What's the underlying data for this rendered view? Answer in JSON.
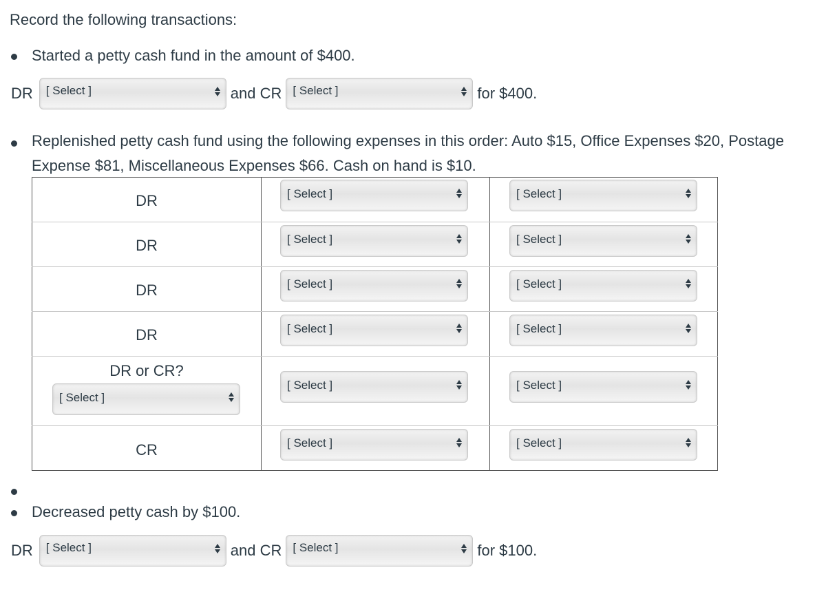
{
  "intro": "Record the following transactions:",
  "select_placeholder": "[ Select ]",
  "q1": {
    "text": "Started a petty cash fund in the amount of $400.",
    "dr_label": "DR",
    "and_cr_label": "and CR",
    "for_label": "for $400."
  },
  "q2": {
    "text": "Replenished petty cash fund using the following expenses in this order: Auto $15, Office Expenses $20, Postage Expense $81, Miscellaneous Expenses $66. Cash on hand is $10.",
    "rows": [
      {
        "label": "DR"
      },
      {
        "label": "DR"
      },
      {
        "label": "DR"
      },
      {
        "label": "DR"
      },
      {
        "label": "DR or CR?"
      },
      {
        "label": "CR"
      }
    ]
  },
  "q3": {
    "text": "Decreased petty cash by $100.",
    "dr_label": "DR",
    "and_cr_label": "and CR",
    "for_label": "for $100."
  }
}
